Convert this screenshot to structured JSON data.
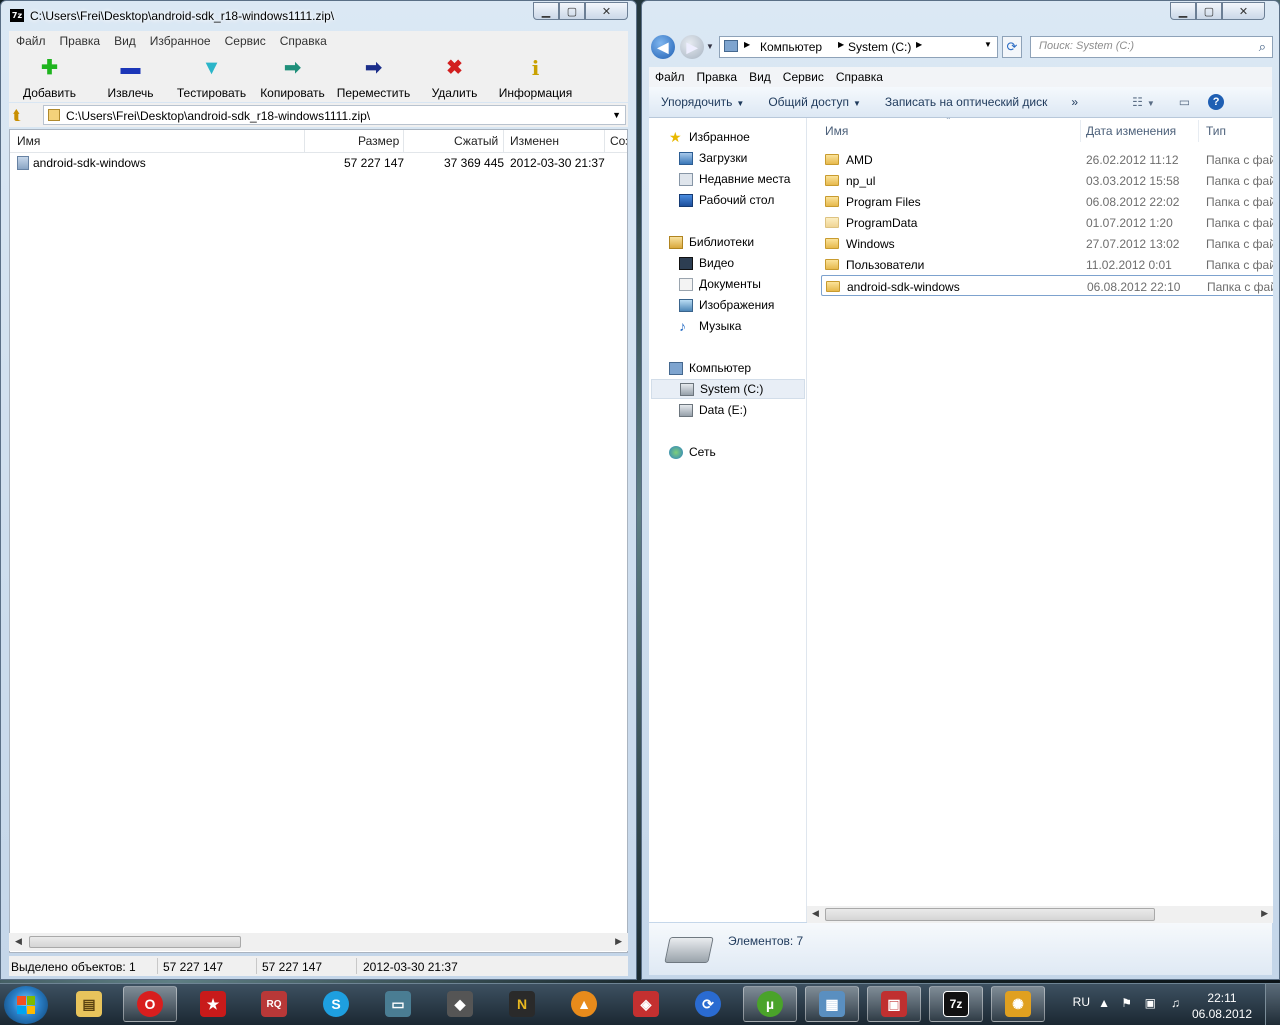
{
  "zip": {
    "title": "C:\\Users\\Frei\\Desktop\\android-sdk_r18-windows1111.zip\\",
    "menu": [
      "Файл",
      "Правка",
      "Вид",
      "Избранное",
      "Сервис",
      "Справка"
    ],
    "toolbar": [
      {
        "label": "Добавить",
        "icon": "add-icon",
        "glyph": "✚",
        "color": "#1fb41f"
      },
      {
        "label": "Извлечь",
        "icon": "extract-icon",
        "glyph": "▬",
        "color": "#1b36b8"
      },
      {
        "label": "Тестировать",
        "icon": "test-icon",
        "glyph": "▼",
        "color": "#2bb5c9"
      },
      {
        "label": "Копировать",
        "icon": "copy-icon",
        "glyph": "➡",
        "color": "#1f8f7a"
      },
      {
        "label": "Переместить",
        "icon": "move-icon",
        "glyph": "➡",
        "color": "#1b2e8a"
      },
      {
        "label": "Удалить",
        "icon": "delete-icon",
        "glyph": "✖",
        "color": "#d21f1f"
      },
      {
        "label": "Информация",
        "icon": "info-icon",
        "glyph": "i",
        "color": "#c9a100"
      }
    ],
    "address": "C:\\Users\\Frei\\Desktop\\android-sdk_r18-windows1111.zip\\",
    "columns": {
      "name": "Имя",
      "size": "Размер",
      "packed": "Сжатый",
      "modified": "Изменен",
      "created": "Соз,"
    },
    "rows": [
      {
        "name": "android-sdk-windows",
        "size": "57 227 147",
        "packed": "37 369 445",
        "modified": "2012-03-30 21:37"
      }
    ],
    "status": {
      "selected": "Выделено объектов: 1",
      "size": "57 227 147",
      "packed": "57 227 147",
      "modified": "2012-03-30 21:37"
    }
  },
  "explorer": {
    "breadcrumb": [
      "Компьютер",
      "System (C:)"
    ],
    "search_placeholder": "Поиск: System (C:)",
    "menu": [
      "Файл",
      "Правка",
      "Вид",
      "Сервис",
      "Справка"
    ],
    "commands": [
      "Упорядочить",
      "Общий доступ",
      "Записать на оптический диск"
    ],
    "more": "»",
    "nav": {
      "favorites": "Избранное",
      "downloads": "Загрузки",
      "recent": "Недавние места",
      "desktop": "Рабочий стол",
      "libraries": "Библиотеки",
      "video": "Видео",
      "documents": "Документы",
      "pictures": "Изображения",
      "music": "Музыка",
      "computer": "Компьютер",
      "system_c": "System (C:)",
      "data_e": "Data (E:)",
      "network": "Сеть"
    },
    "columns": {
      "name": "Имя",
      "date": "Дата изменения",
      "type": "Тип"
    },
    "rows": [
      {
        "name": "AMD",
        "date": "26.02.2012 11:12",
        "type": "Папка с фай"
      },
      {
        "name": "np_ul",
        "date": "03.03.2012 15:58",
        "type": "Папка с фай"
      },
      {
        "name": "Program Files",
        "date": "06.08.2012 22:02",
        "type": "Папка с фай"
      },
      {
        "name": "ProgramData",
        "date": "01.07.2012 1:20",
        "type": "Папка с фай"
      },
      {
        "name": "Windows",
        "date": "27.07.2012 13:02",
        "type": "Папка с фай"
      },
      {
        "name": "Пользователи",
        "date": "11.02.2012 0:01",
        "type": "Папка с фай"
      },
      {
        "name": "android-sdk-windows",
        "date": "06.08.2012 22:10",
        "type": "Папка с фай"
      }
    ],
    "item_count": "Элементов: 7"
  },
  "taskbar": {
    "apps": [
      {
        "name": "explorer",
        "glyph": "▤",
        "bg": "#e8c45c"
      },
      {
        "name": "opera",
        "glyph": "O",
        "bg": "#d81e1e"
      },
      {
        "name": "pokerstars",
        "glyph": "★",
        "bg": "#c81a1a"
      },
      {
        "name": "rq",
        "glyph": "RQ",
        "bg": "#b83838"
      },
      {
        "name": "skype",
        "glyph": "S",
        "bg": "#1e9fe0"
      },
      {
        "name": "monitor",
        "glyph": "▭",
        "bg": "#4a7d93"
      },
      {
        "name": "game",
        "glyph": "◆",
        "bg": "#555"
      },
      {
        "name": "nfs",
        "glyph": "N",
        "bg": "#2a2a2a"
      },
      {
        "name": "aimp",
        "glyph": "▲",
        "bg": "#e88b1b"
      },
      {
        "name": "app-red",
        "glyph": "◈",
        "bg": "#c43030"
      },
      {
        "name": "sync",
        "glyph": "⟳",
        "bg": "#2a6bd1"
      },
      {
        "name": "utorrent",
        "glyph": "µ",
        "bg": "#4aa32a"
      },
      {
        "name": "control-panel",
        "glyph": "▦",
        "bg": "#5a8fc0"
      },
      {
        "name": "toolbox",
        "glyph": "▣",
        "bg": "#c03030"
      },
      {
        "name": "7zip",
        "glyph": "7z",
        "bg": "#111"
      },
      {
        "name": "viewer",
        "glyph": "✺",
        "bg": "#e0a020"
      }
    ],
    "lang": "RU",
    "time": "22:11",
    "date": "06.08.2012"
  }
}
